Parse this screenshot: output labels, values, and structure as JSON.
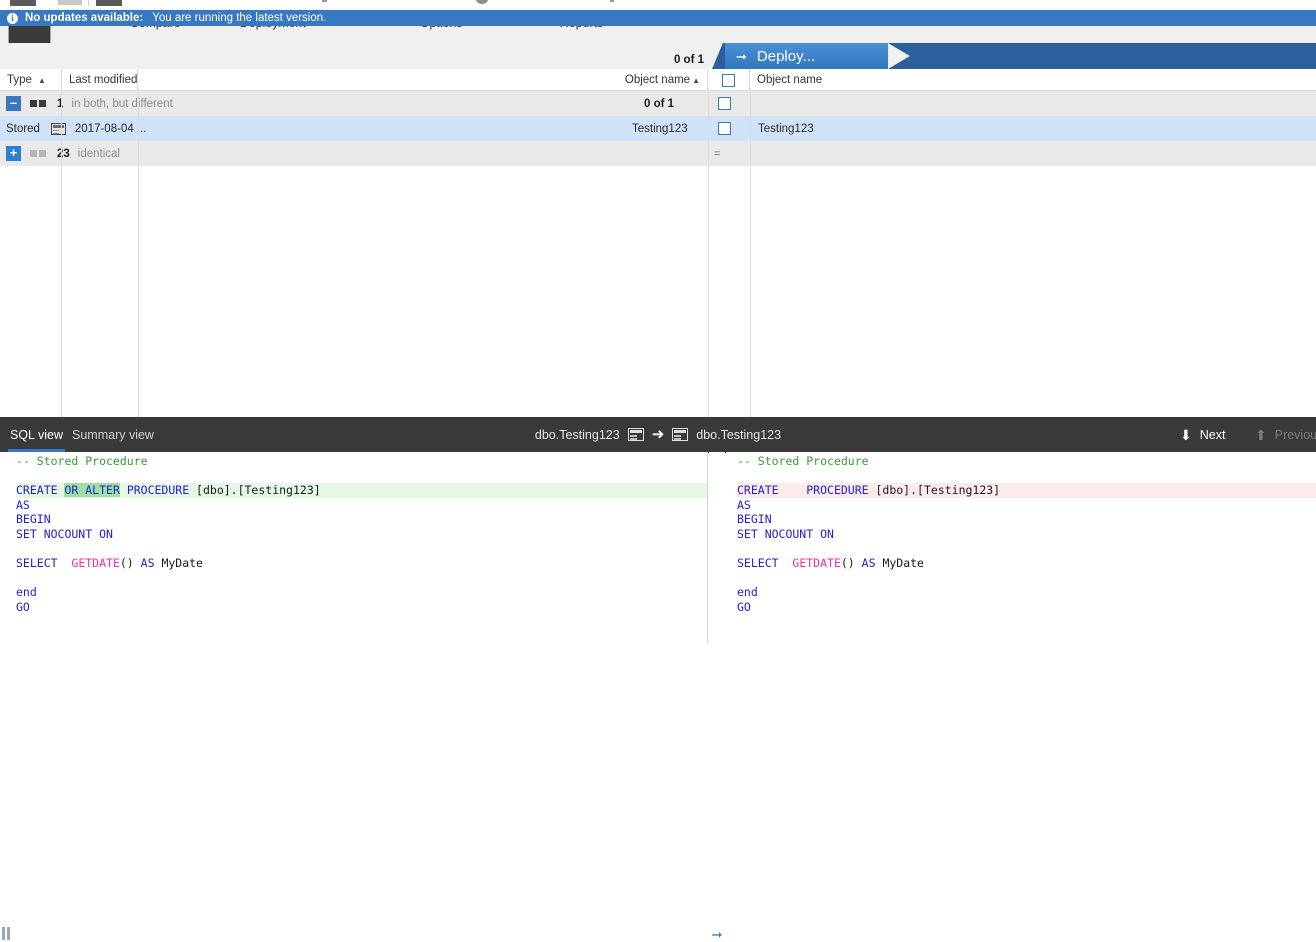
{
  "notification": {
    "icon": "info-icon",
    "title": "No updates available:",
    "message": "You are running the latest version.",
    "background": "#3878c0"
  },
  "results_header": {
    "selection_count": "0 of 1",
    "deploy_button": {
      "label": "Deploy...",
      "icon": "right-arrow-icon"
    },
    "accent": "#4a90d9"
  },
  "grid": {
    "columns": [
      {
        "label": "Type",
        "sort": "▲",
        "align": "left"
      },
      {
        "label": "Last modified",
        "sort": "",
        "align": "left"
      },
      {
        "label": "Object name",
        "sort": "▲",
        "align": "right"
      },
      {
        "label": "",
        "sort": "",
        "align": "center",
        "icon": "checkbox-header"
      },
      {
        "label": "Object name",
        "sort": "",
        "align": "left"
      }
    ],
    "groups": [
      {
        "expander": "–",
        "expander_state": "expanded",
        "swatches": [
          "dark",
          "dark"
        ],
        "count": "1",
        "description": "in both, but different",
        "right_count": "0 of 1",
        "checkbox": "unchecked",
        "rows": [
          {
            "type": "Stored",
            "type_icon": "stored-procedure-icon",
            "last_modified": "2017-08-04 ...",
            "object_name_left": "Testing123",
            "checkbox": "unchecked",
            "object_name_right": "Testing123",
            "selected": true
          }
        ]
      },
      {
        "expander": "+",
        "expander_state": "collapsed",
        "swatches": [
          "light",
          "light"
        ],
        "count": "23",
        "description": "identical",
        "right_symbol": "=",
        "rows": []
      }
    ]
  },
  "sql_bar": {
    "tabs": [
      {
        "label": "SQL view",
        "active": true
      },
      {
        "label": "Summary view",
        "active": false
      }
    ],
    "center": {
      "left_name": "dbo.Testing123",
      "left_icon": "stored-procedure-icon",
      "arrow": "➜",
      "right_icon": "stored-procedure-icon",
      "right_name": "dbo.Testing123"
    },
    "nav": [
      {
        "label": "Next",
        "glyph": "⬇",
        "enabled": true
      },
      {
        "label": "Previous",
        "glyph": "⬆",
        "enabled": false
      }
    ]
  },
  "diff": {
    "left_marker": "pause-marker-icon",
    "right_marker": "right-arrow-marker-icon",
    "left_lines": [
      {
        "highlight": "none",
        "segments": [
          {
            "text": "-- Stored Procedure",
            "style": "comment"
          }
        ]
      },
      {
        "highlight": "none",
        "segments": []
      },
      {
        "highlight": "add",
        "segments": [
          {
            "text": "CREATE",
            "style": "kw"
          },
          {
            "text": " ",
            "style": "plain"
          },
          {
            "text": "OR ALTER",
            "style": "word-add"
          },
          {
            "text": " ",
            "style": "plain"
          },
          {
            "text": "PROCEDURE",
            "style": "kw"
          },
          {
            "text": " [dbo].[Testing123]",
            "style": "plain"
          }
        ]
      },
      {
        "highlight": "none",
        "segments": [
          {
            "text": "AS",
            "style": "kw"
          }
        ]
      },
      {
        "highlight": "none",
        "segments": [
          {
            "text": "BEGIN",
            "style": "kw"
          }
        ]
      },
      {
        "highlight": "none",
        "segments": [
          {
            "text": "SET NOCOUNT ON",
            "style": "kw"
          }
        ]
      },
      {
        "highlight": "none",
        "segments": []
      },
      {
        "highlight": "none",
        "segments": [
          {
            "text": "SELECT",
            "style": "kw"
          },
          {
            "text": "  ",
            "style": "plain"
          },
          {
            "text": "GETDATE",
            "style": "fn"
          },
          {
            "text": "() ",
            "style": "plain"
          },
          {
            "text": "AS",
            "style": "kw"
          },
          {
            "text": " MyDate",
            "style": "plain"
          }
        ]
      },
      {
        "highlight": "none",
        "segments": []
      },
      {
        "highlight": "none",
        "segments": [
          {
            "text": "end",
            "style": "kw"
          }
        ]
      },
      {
        "highlight": "none",
        "segments": [
          {
            "text": "GO",
            "style": "kw"
          }
        ]
      }
    ],
    "right_lines": [
      {
        "highlight": "none",
        "segments": [
          {
            "text": "-- Stored Procedure",
            "style": "comment"
          }
        ]
      },
      {
        "highlight": "none",
        "segments": []
      },
      {
        "highlight": "del",
        "segments": [
          {
            "text": "CREATE",
            "style": "kw"
          },
          {
            "text": "    ",
            "style": "plain"
          },
          {
            "text": "PROCEDURE",
            "style": "kw"
          },
          {
            "text": " [dbo].[Testing123]",
            "style": "plain"
          }
        ]
      },
      {
        "highlight": "none",
        "segments": [
          {
            "text": "AS",
            "style": "kw"
          }
        ]
      },
      {
        "highlight": "none",
        "segments": [
          {
            "text": "BEGIN",
            "style": "kw"
          }
        ]
      },
      {
        "highlight": "none",
        "segments": [
          {
            "text": "SET NOCOUNT ON",
            "style": "kw"
          }
        ]
      },
      {
        "highlight": "none",
        "segments": []
      },
      {
        "highlight": "none",
        "segments": [
          {
            "text": "SELECT",
            "style": "kw"
          },
          {
            "text": "  ",
            "style": "plain"
          },
          {
            "text": "GETDATE",
            "style": "fn"
          },
          {
            "text": "() ",
            "style": "plain"
          },
          {
            "text": "AS",
            "style": "kw"
          },
          {
            "text": " MyDate",
            "style": "plain"
          }
        ]
      },
      {
        "highlight": "none",
        "segments": []
      },
      {
        "highlight": "none",
        "segments": [
          {
            "text": "end",
            "style": "kw"
          }
        ]
      },
      {
        "highlight": "none",
        "segments": [
          {
            "text": "GO",
            "style": "kw"
          }
        ]
      }
    ]
  }
}
